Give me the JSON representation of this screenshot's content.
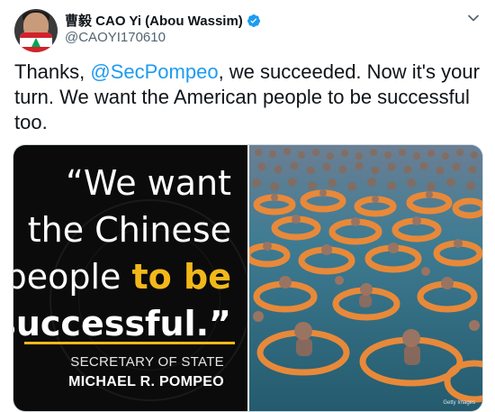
{
  "tweet": {
    "author": {
      "display_name": "曹毅 CAO Yi (Abou Wassim)",
      "handle": "@CAOYI170610",
      "verified": true
    },
    "text": {
      "before_mention": "Thanks, ",
      "mention": "@SecPompeo",
      "after_mention": ", we succeeded. Now it's your turn. We want the American people to be successful too."
    },
    "media": {
      "left_image": {
        "quote_lines": [
          "“We want",
          "the Chinese",
          "people ",
          "to be",
          "successful.”"
        ],
        "attribution_title": "SECRETARY OF STATE",
        "attribution_name": "MICHAEL R. POMPEO"
      },
      "right_image": {
        "photo_credit": "Getty Images"
      }
    }
  },
  "colors": {
    "accent": "#1d9bf0",
    "gold": "#f2b81a",
    "water": "#2f6f86",
    "tube_orange": "#e8893a"
  }
}
